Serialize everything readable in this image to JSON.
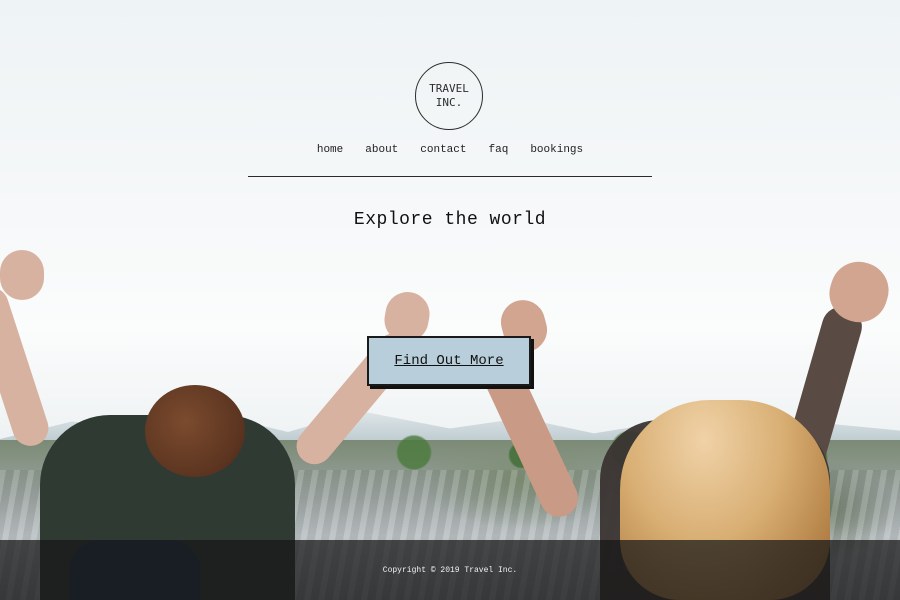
{
  "brand": {
    "logo_line_1": "TRAVEL",
    "logo_line_2": "INC."
  },
  "nav": {
    "items": [
      {
        "label": "home"
      },
      {
        "label": "about"
      },
      {
        "label": "contact"
      },
      {
        "label": "faq"
      },
      {
        "label": "bookings"
      }
    ]
  },
  "hero": {
    "headline": "Explore the world",
    "cta_label": "Find Out More"
  },
  "footer": {
    "copyright": "Copyright © 2019 Travel Inc."
  },
  "colors": {
    "text": "#111111",
    "cta_background": "#b8cfdb",
    "footer_background": "rgba(22,22,22,0.72)"
  }
}
